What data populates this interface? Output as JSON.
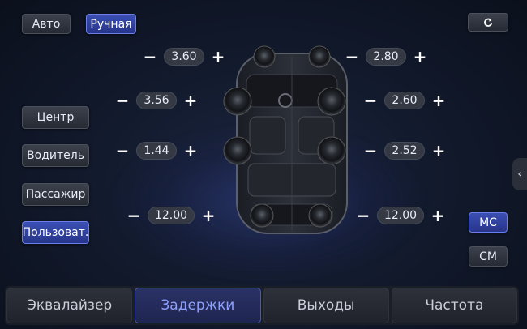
{
  "mode": {
    "auto_label": "Авто",
    "manual_label": "Ручная"
  },
  "reset_icon": "refresh-icon",
  "presets": [
    {
      "label": "Центр"
    },
    {
      "label": "Водитель"
    },
    {
      "label": "Пассажир"
    },
    {
      "label": "Пользоват."
    }
  ],
  "units": {
    "ms_label": "МС",
    "cm_label": "СМ"
  },
  "delays": {
    "front_left": "3.60",
    "front_right": "2.80",
    "door_front_left": "3.56",
    "door_front_right": "2.60",
    "door_rear_left": "1.44",
    "door_rear_right": "2.52",
    "rear_left": "12.00",
    "rear_right": "12.00"
  },
  "symbols": {
    "minus": "−",
    "plus": "+"
  },
  "tabs": [
    {
      "label": "Эквалайзер"
    },
    {
      "label": "Задержки"
    },
    {
      "label": "Выходы"
    },
    {
      "label": "Частота"
    }
  ],
  "colors": {
    "accent": "#3b4fb3",
    "accent_text": "#8ea0ff",
    "background": "#121a2d"
  }
}
